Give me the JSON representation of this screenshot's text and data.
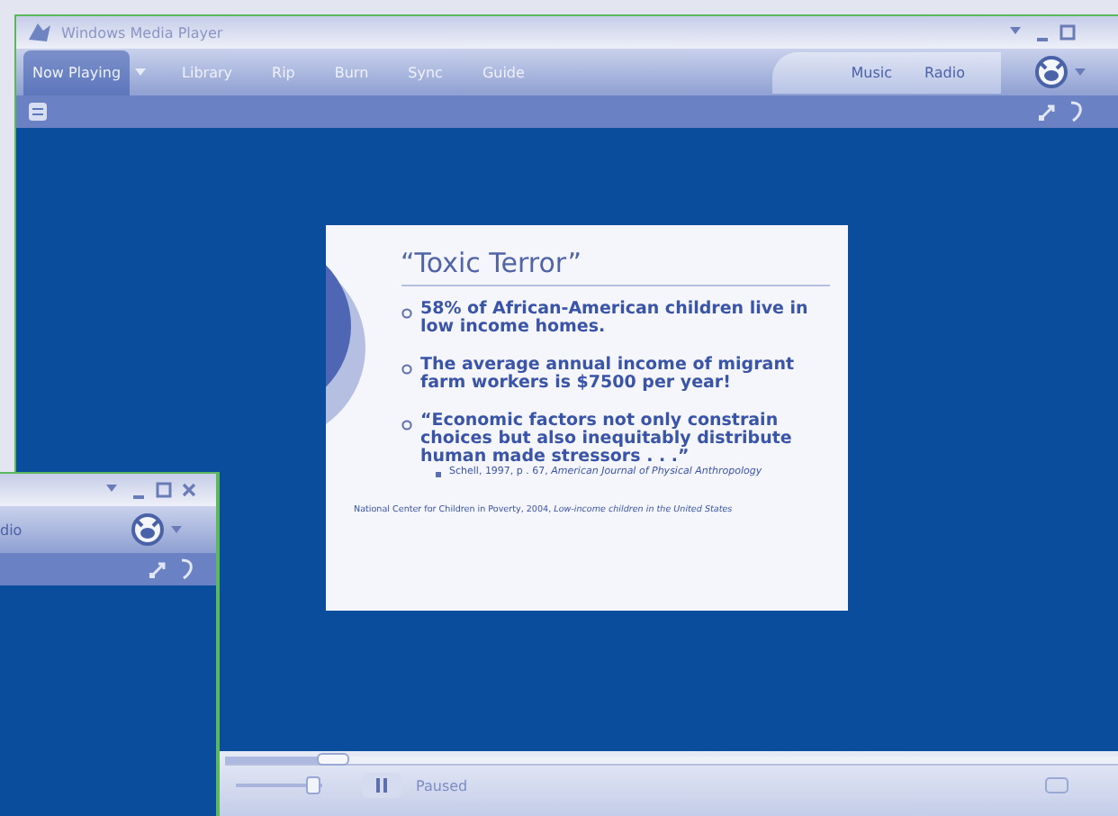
{
  "main_window": {
    "title": "Windows Media Player",
    "tabs": [
      {
        "label": "Now Playing",
        "selected": true
      },
      {
        "label": "Library",
        "selected": false
      },
      {
        "label": "Rip",
        "selected": false
      },
      {
        "label": "Burn",
        "selected": false
      },
      {
        "label": "Sync",
        "selected": false
      },
      {
        "label": "Guide",
        "selected": false
      }
    ],
    "services": [
      {
        "label": "Music"
      },
      {
        "label": "Radio"
      }
    ],
    "slide": {
      "title": "“Toxic Terror”",
      "bullets": [
        {
          "text": "58% of African-American children live in low income homes."
        },
        {
          "text": "The average annual income of migrant farm workers is $7500 per year!"
        },
        {
          "text": "“Economic factors not only constrain choices but also inequitably distribute human made stressors . . .”",
          "sub": "Schell, 1997, p . 67, *American Journal of Physical Anthropology*"
        }
      ],
      "footer": "National Center for Children in Poverty, 2004, *Low-income children in the United States*"
    },
    "seek": {
      "level": 0.12
    },
    "volume": {
      "level": 0.9
    },
    "status": "Paused"
  },
  "front_window": {
    "tab_fragment": "dio"
  }
}
